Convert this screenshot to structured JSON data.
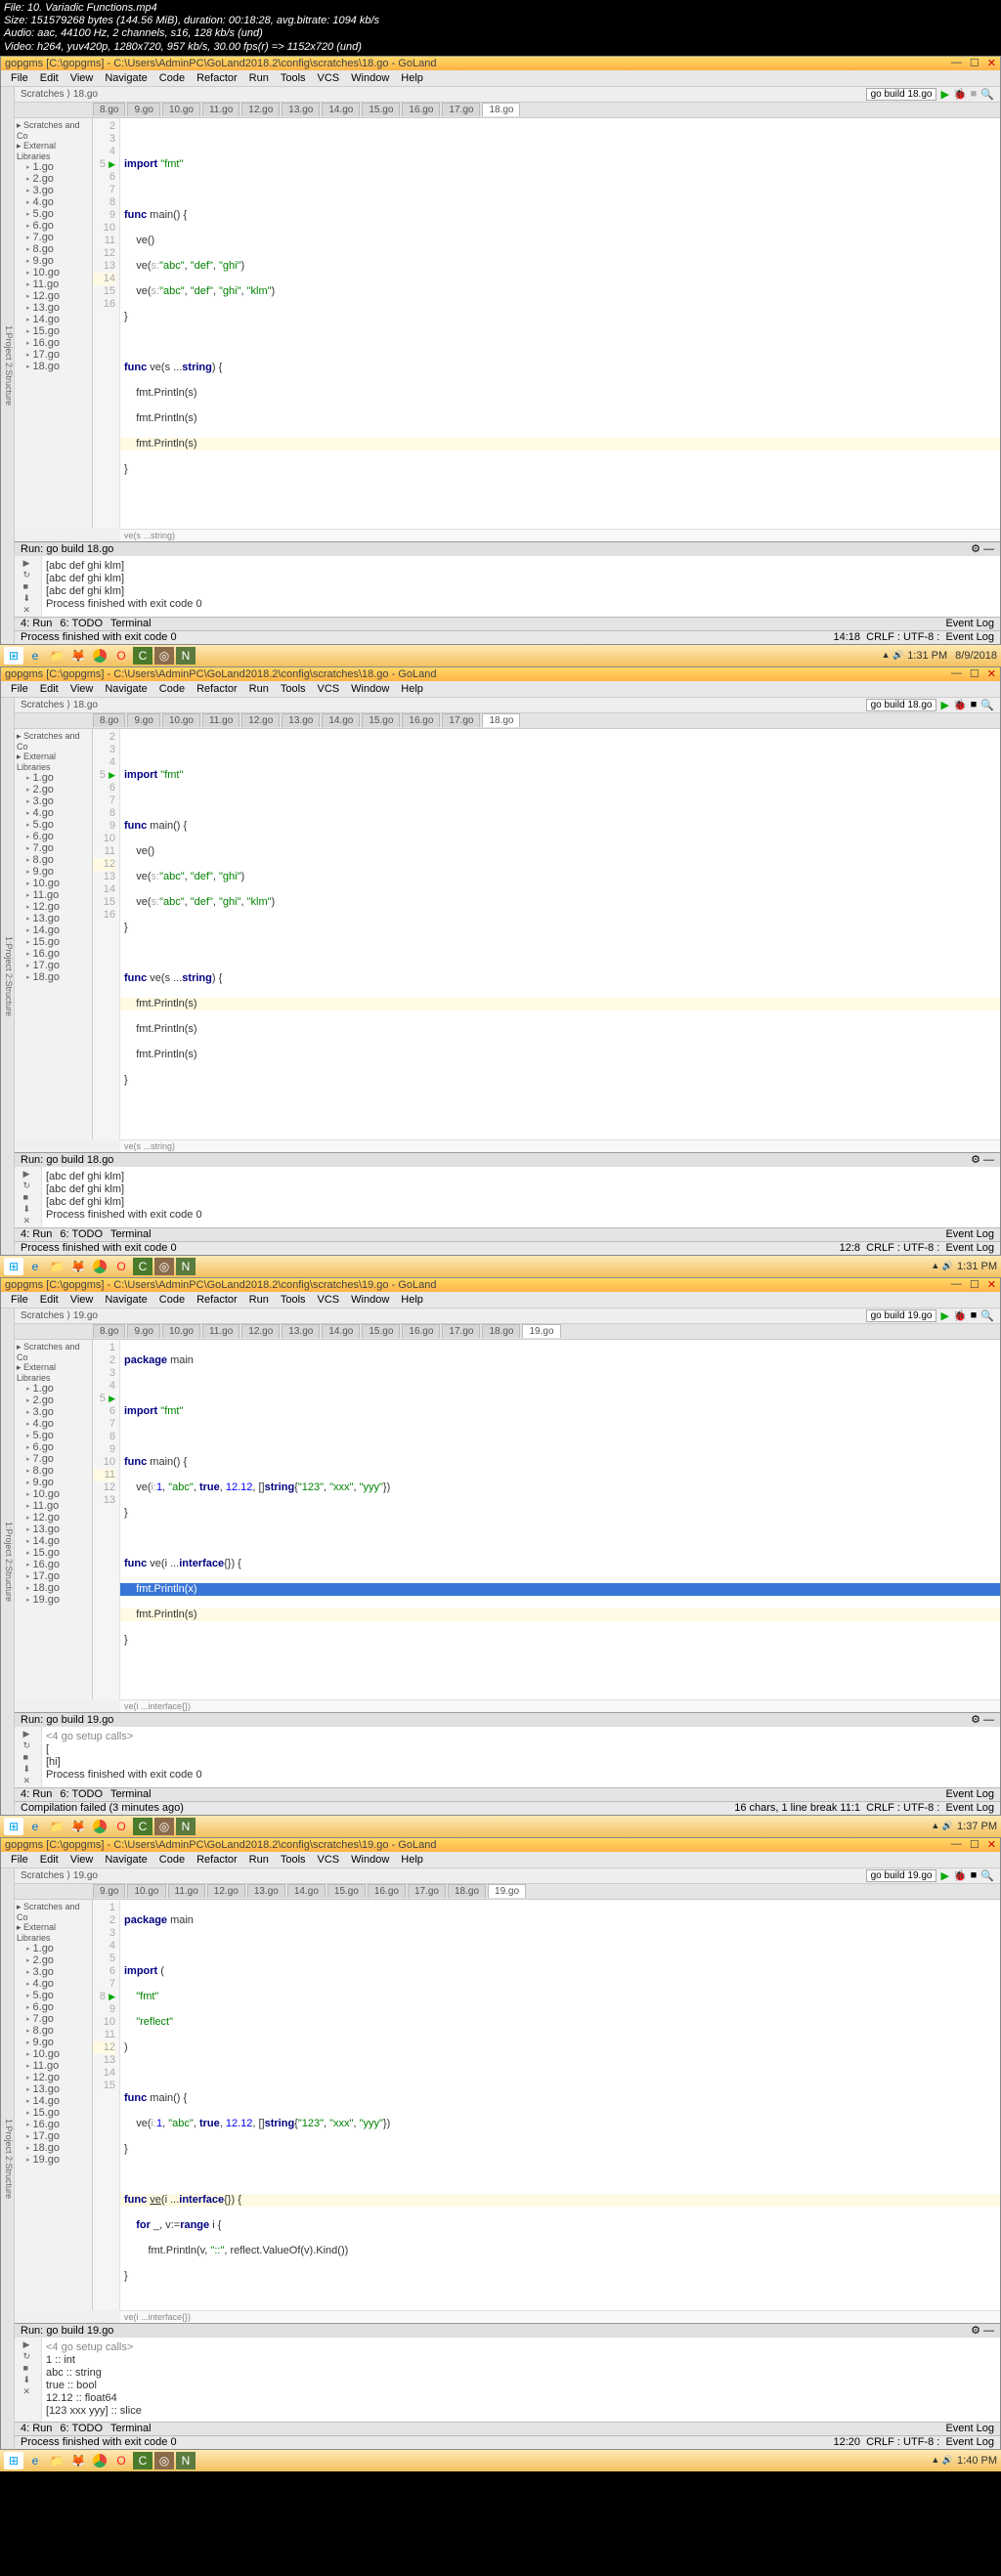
{
  "overlay": {
    "file": "File: 10. Variadic Functions.mp4",
    "size": "Size: 151579268 bytes (144.56 MiB), duration: 00:18:28, avg.bitrate: 1094 kb/s",
    "audio": "Audio: aac, 44100 Hz, 2 channels, s16, 128 kb/s (und)",
    "video": "Video: h264, yuv420p, 1280x720, 957 kb/s, 30.00 fps(r) => 1152x720 (und)"
  },
  "menu": [
    "File",
    "Edit",
    "View",
    "Navigate",
    "Code",
    "Refactor",
    "Run",
    "Tools",
    "VCS",
    "Window",
    "Help"
  ],
  "title18": "gopgms [C:\\gopgms] - C:\\Users\\AdminPC\\GoLand2018.2\\config\\scratches\\18.go - GoLand",
  "title19": "gopgms [C:\\gopgms] - C:\\Users\\AdminPC\\GoLand2018.2\\config\\scratches\\19.go - GoLand",
  "bc": "Scratches ⟩ 18.go",
  "bc19": "Scratches ⟩ 19.go",
  "runcfg18": "go build 18.go",
  "runcfg19": "go build 19.go",
  "tabs18": [
    "8.go",
    "9.go",
    "10.go",
    "11.go",
    "12.go",
    "13.go",
    "14.go",
    "15.go",
    "16.go",
    "17.go",
    "18.go"
  ],
  "tabs19a": [
    "8.go",
    "9.go",
    "10.go",
    "11.go",
    "12.go",
    "13.go",
    "14.go",
    "15.go",
    "16.go",
    "17.go",
    "18.go",
    "19.go"
  ],
  "tabs19b": [
    "9.go",
    "10.go",
    "11.go",
    "12.go",
    "13.go",
    "14.go",
    "15.go",
    "16.go",
    "17.go",
    "18.go",
    "19.go"
  ],
  "tree": {
    "root": "Scratches and Co",
    "ext": "External Libraries",
    "items": [
      "1.go",
      "2.go",
      "3.go",
      "4.go",
      "5.go",
      "6.go",
      "7.go",
      "8.go",
      "9.go",
      "10.go",
      "11.go",
      "12.go",
      "13.go",
      "14.go",
      "15.go",
      "16.go",
      "17.go",
      "18.go"
    ]
  },
  "tree19": [
    "1.go",
    "2.go",
    "3.go",
    "4.go",
    "5.go",
    "6.go",
    "7.go",
    "8.go",
    "9.go",
    "10.go",
    "11.go",
    "12.go",
    "13.go",
    "14.go",
    "15.go",
    "16.go",
    "17.go",
    "18.go",
    "19.go"
  ],
  "codeA": {
    "l3": "import \"fmt\"",
    "l5": "func main() {",
    "l6": "    ve()",
    "l7": "    ve(s:\"abc\", \"def\", \"ghi\")",
    "l8": "    ve(s:\"abc\", \"def\", \"ghi\", \"klm\")",
    "l9": "}",
    "l11": "func ve(s ...string) {",
    "l12": "    fmt.Println(s)",
    "l13": "    fmt.Println(s)",
    "l14": "    fmt.Println(s)",
    "l15": "}",
    "bc": "ve(s ...string)"
  },
  "consoleA": [
    "[abc def ghi klm]",
    "[abc def ghi klm]",
    "[abc def ghi klm]",
    "",
    "Process finished with exit code 0"
  ],
  "codeC": {
    "l1": "package main",
    "l3": "import \"fmt\"",
    "l5": "func main() {",
    "l6": "    ve(i:1, \"abc\", true, 12.12, []string{\"123\", \"xxx\", \"yyy\"})",
    "l7": "}",
    "l9": "func ve(i ...interface{}) {",
    "l10": "    fmt.Println(x)",
    "l11": "    fmt.Println(s)",
    "l12": "}",
    "bc": "ve(i ...interface{})"
  },
  "consoleC": [
    "<4 go setup calls>",
    "[",
    "[hi]",
    "",
    "Process finished with exit code 0"
  ],
  "codeD": {
    "l1": "package main",
    "l3": "import (",
    "l4": "    \"fmt\"",
    "l5": "    \"reflect\"",
    "l6": ")",
    "l8": "func main() {",
    "l9": "    ve(i:1, \"abc\", true, 12.12, []string{\"123\", \"xxx\", \"yyy\"})",
    "l10": "}",
    "l12": "func ve(i ...interface{}) {",
    "l13": "    for _, v:=range i {",
    "l14": "        fmt.Println(v, \"::\", reflect.ValueOf(v).Kind())",
    "l15": "}",
    "bc": "ve(i ...interface{})"
  },
  "consoleD": [
    "<4 go setup calls>",
    "1 :: int",
    "abc :: string",
    "true :: bool",
    "12.12 :: float64",
    "[123 xxx yyy] :: slice"
  ],
  "status1": {
    "msg": "Process finished with exit code 0",
    "pos": "14:18",
    "enc": "CRLF : UTF-8 :",
    "log": "Event Log"
  },
  "status2": {
    "pos": "12:8",
    "enc": "CRLF : UTF-8 :"
  },
  "status3": {
    "msg": "Compilation failed (3 minutes ago)",
    "pos": "16 chars, 1 line break   11:1",
    "enc": "CRLF : UTF-8 :"
  },
  "status4": {
    "pos": "12:20",
    "enc": "CRLF : UTF-8 :"
  },
  "bottom": [
    "4: Run",
    "6: TODO",
    "Terminal"
  ],
  "runLabel": "Run:",
  "tray": {
    "t1": "1:31 PM",
    "d1": "8/9/2018",
    "t2": "1:31 PM",
    "t3": "1:37 PM",
    "t4": "1:40 PM"
  }
}
